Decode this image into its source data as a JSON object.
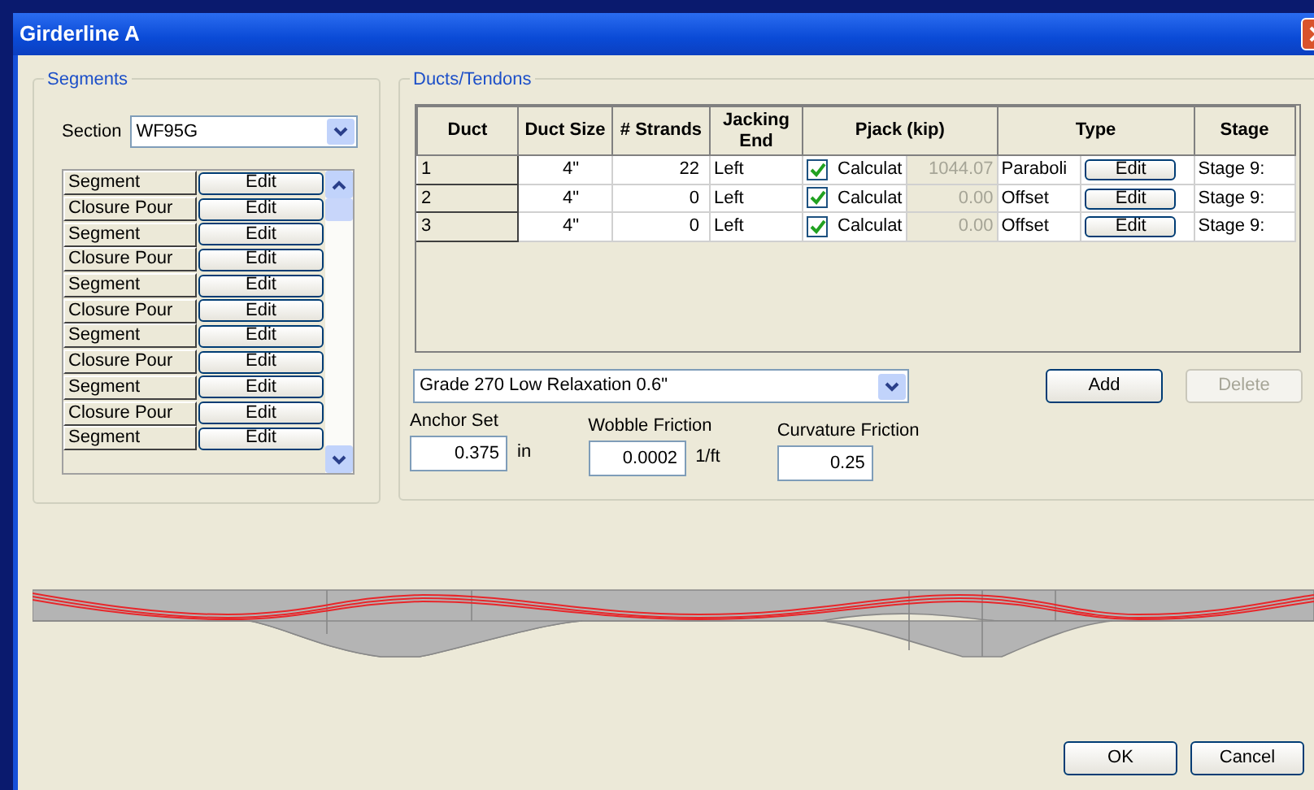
{
  "window": {
    "title": "Girderline A"
  },
  "segments": {
    "title": "Segments",
    "section_label": "Section",
    "section_value": "WF95G",
    "items": [
      {
        "label": "Segment",
        "button": "Edit"
      },
      {
        "label": "Closure Pour",
        "button": "Edit"
      },
      {
        "label": "Segment",
        "button": "Edit"
      },
      {
        "label": "Closure Pour",
        "button": "Edit"
      },
      {
        "label": "Segment",
        "button": "Edit"
      },
      {
        "label": "Closure Pour",
        "button": "Edit"
      },
      {
        "label": "Segment",
        "button": "Edit"
      },
      {
        "label": "Closure Pour",
        "button": "Edit"
      },
      {
        "label": "Segment",
        "button": "Edit"
      },
      {
        "label": "Closure Pour",
        "button": "Edit"
      },
      {
        "label": "Segment",
        "button": "Edit"
      }
    ]
  },
  "ducts": {
    "title": "Ducts/Tendons",
    "columns": [
      "Duct",
      "Duct Size",
      "# Strands",
      "Jacking End",
      "Pjack (kip)",
      "Type",
      "Stage"
    ],
    "rows": [
      {
        "duct": "1",
        "size": "4\"",
        "strands": "22",
        "jacking_end": "Left",
        "calculate": "Calculat",
        "checked": true,
        "pjack": "1044.07",
        "type": "Paraboli",
        "type_button": "Edit",
        "stage": "Stage 9:"
      },
      {
        "duct": "2",
        "size": "4\"",
        "strands": "0",
        "jacking_end": "Left",
        "calculate": "Calculat",
        "checked": true,
        "pjack": "0.00",
        "type": "Offset",
        "type_button": "Edit",
        "stage": "Stage 9:"
      },
      {
        "duct": "3",
        "size": "4\"",
        "strands": "0",
        "jacking_end": "Left",
        "calculate": "Calculat",
        "checked": true,
        "pjack": "0.00",
        "type": "Offset",
        "type_button": "Edit",
        "stage": "Stage 9:"
      }
    ],
    "strand": "Grade 270 Low Relaxation 0.6\"",
    "add": {
      "label": "Add",
      "disabled": false
    },
    "delete": {
      "label": "Delete",
      "disabled": true
    },
    "fields": [
      {
        "label": "Anchor Set",
        "value": "0.375",
        "unit": "in"
      },
      {
        "label": "Wobble Friction",
        "value": "0.0002",
        "unit": "1/ft"
      },
      {
        "label": "Curvature Friction",
        "value": "0.25"
      }
    ]
  },
  "buttons": [
    "OK",
    "Cancel"
  ]
}
